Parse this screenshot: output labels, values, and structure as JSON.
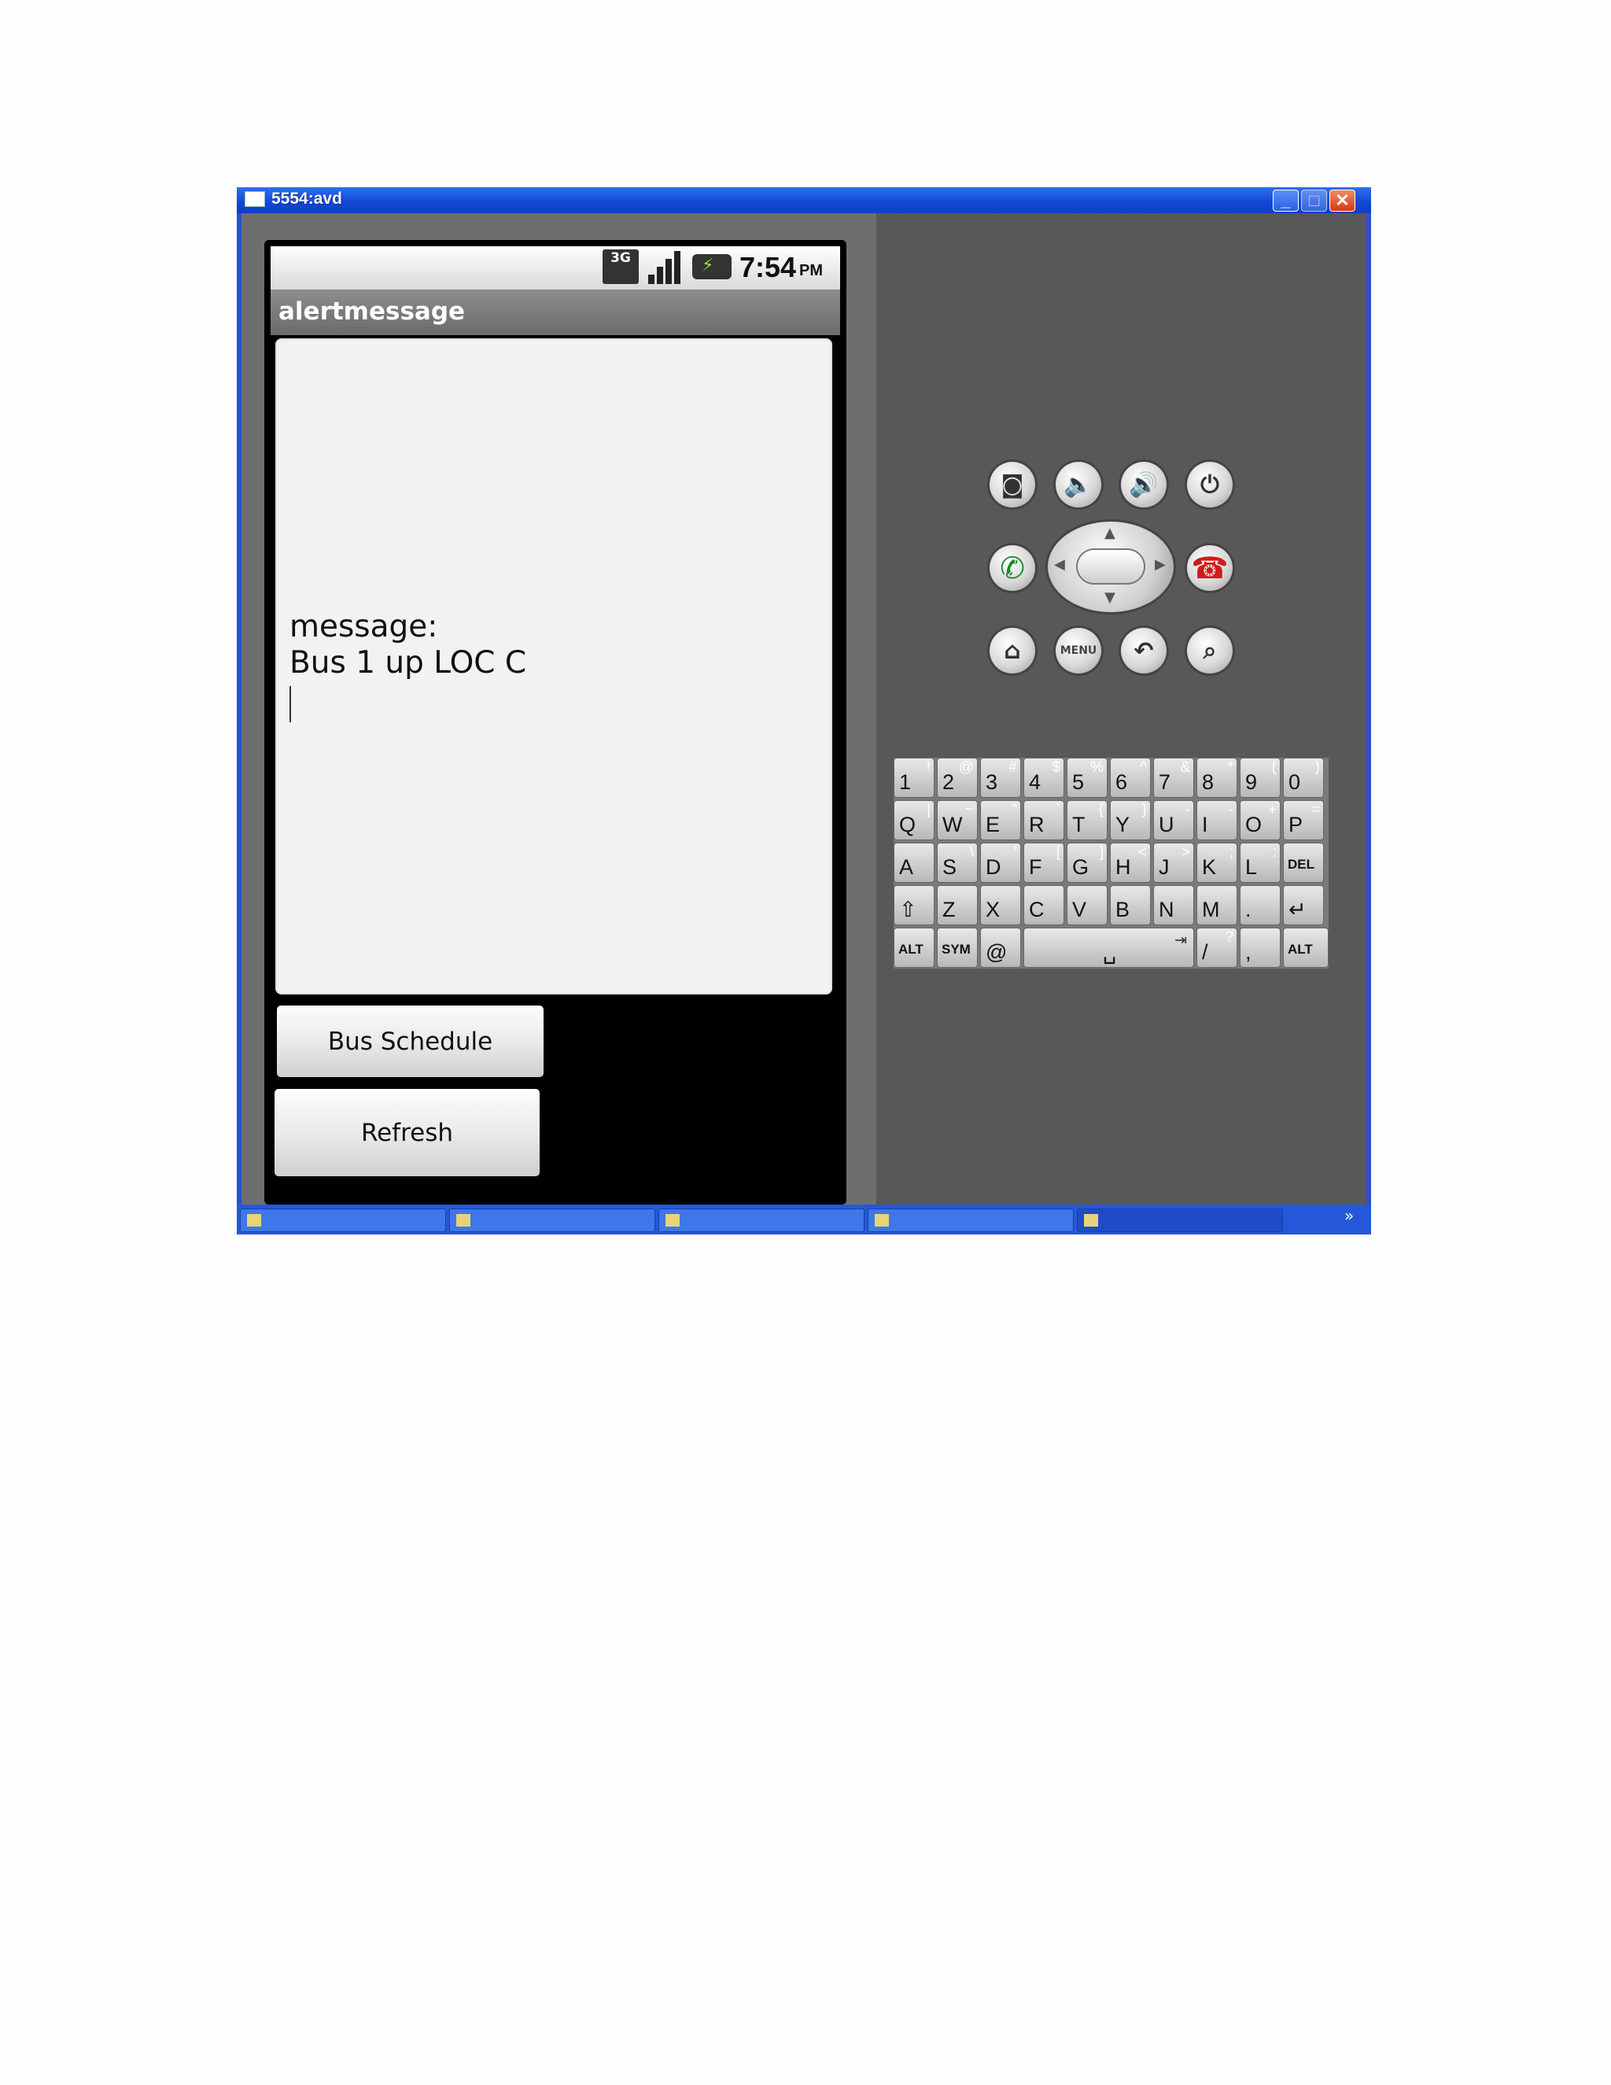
{
  "window": {
    "title": "5554:avd",
    "minimize_glyph": "_",
    "maximize_glyph": "□",
    "close_glyph": "✕"
  },
  "status_bar": {
    "network": "3G",
    "time": "7:54",
    "ampm": "PM"
  },
  "app": {
    "title": "alertmessage",
    "message_label": "message:",
    "message_text": "Bus 1 up LOC C",
    "bus_schedule_label": "Bus Schedule",
    "refresh_label": "Refresh"
  },
  "hardware_buttons": {
    "menu_label": "MENU"
  },
  "keyboard": {
    "row1": [
      {
        "m": "1",
        "s": "!"
      },
      {
        "m": "2",
        "s": "@"
      },
      {
        "m": "3",
        "s": "#"
      },
      {
        "m": "4",
        "s": "$"
      },
      {
        "m": "5",
        "s": "%"
      },
      {
        "m": "6",
        "s": "^"
      },
      {
        "m": "7",
        "s": "&"
      },
      {
        "m": "8",
        "s": "*"
      },
      {
        "m": "9",
        "s": "("
      },
      {
        "m": "0",
        "s": ")"
      }
    ],
    "row2": [
      {
        "m": "Q",
        "s": "|"
      },
      {
        "m": "W",
        "s": "~"
      },
      {
        "m": "E",
        "s": "\""
      },
      {
        "m": "R",
        "s": "`"
      },
      {
        "m": "T",
        "s": "{"
      },
      {
        "m": "Y",
        "s": "}"
      },
      {
        "m": "U",
        "s": "-"
      },
      {
        "m": "I",
        "s": "-"
      },
      {
        "m": "O",
        "s": "+"
      },
      {
        "m": "P",
        "s": "="
      }
    ],
    "row3": [
      {
        "m": "A",
        "s": ""
      },
      {
        "m": "S",
        "s": "\\"
      },
      {
        "m": "D",
        "s": "'"
      },
      {
        "m": "F",
        "s": "["
      },
      {
        "m": "G",
        "s": "]"
      },
      {
        "m": "H",
        "s": "<"
      },
      {
        "m": "J",
        "s": ">"
      },
      {
        "m": "K",
        "s": ";"
      },
      {
        "m": "L",
        "s": ":"
      },
      {
        "m": "DEL",
        "s": ""
      }
    ],
    "row4": [
      {
        "m": "⇧",
        "s": ""
      },
      {
        "m": "Z",
        "s": ""
      },
      {
        "m": "X",
        "s": ""
      },
      {
        "m": "C",
        "s": ""
      },
      {
        "m": "V",
        "s": ""
      },
      {
        "m": "B",
        "s": ""
      },
      {
        "m": "N",
        "s": ""
      },
      {
        "m": "M",
        "s": ""
      },
      {
        "m": ".",
        "s": ""
      },
      {
        "m": "↵",
        "s": ""
      }
    ],
    "row5": {
      "alt_left": "ALT",
      "sym": "SYM",
      "at": "@",
      "space": "␣",
      "tab": "⇥",
      "slash": "/",
      "question": "?",
      "comma": ",",
      "alt_right": "ALT"
    }
  },
  "taskbar": {
    "chevron": "»"
  },
  "colors": {
    "title_bar": "#1248d4",
    "call_green": "#1c8a2a",
    "end_red": "#d21a1a"
  }
}
